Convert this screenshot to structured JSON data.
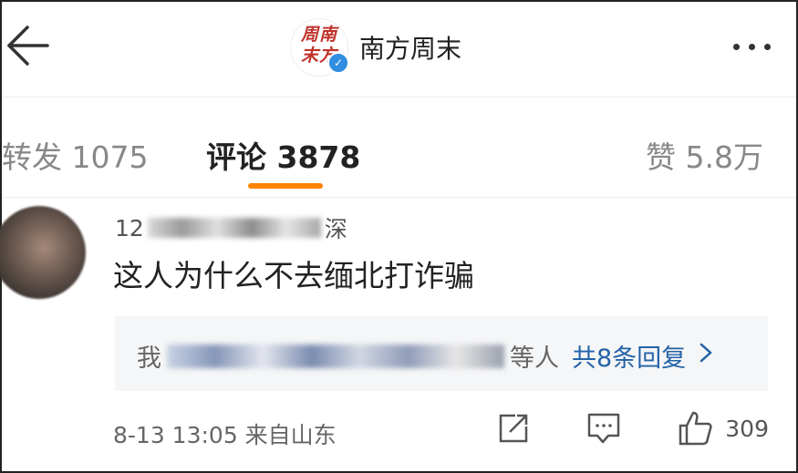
{
  "header": {
    "brand_name": "南方周末",
    "logo_text": "周南\n末方"
  },
  "tabs": {
    "repost": "转发 1075",
    "comment": "评论 3878",
    "like": "赞 5.8万"
  },
  "comment": {
    "username_prefix": "12",
    "username_suffix": "深",
    "text": "这人为什么不去缅北打诈骗",
    "reply_prefix": "我",
    "reply_suffix": "等人",
    "reply_count": "共8条回复",
    "meta": "8-13 13:05 来自山东",
    "like_count": "309"
  },
  "colors": {
    "accent": "#ff8200",
    "link": "#2462a8",
    "verified": "#2f8ee0",
    "logo_red": "#c0312b"
  },
  "icons": [
    "back-arrow-icon",
    "verified-icon",
    "more-icon",
    "repost-icon",
    "comment-icon",
    "like-icon",
    "chevron-right-icon"
  ]
}
